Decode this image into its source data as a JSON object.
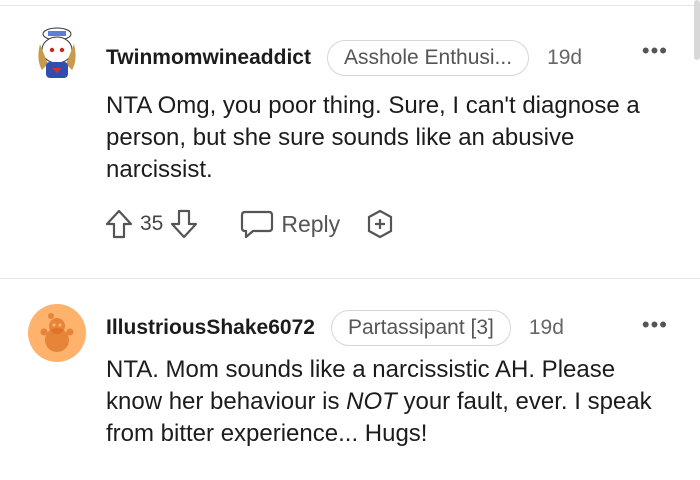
{
  "comments": [
    {
      "username": "Twinmomwineaddict",
      "flair": "Asshole Enthusi...",
      "age": "19d",
      "more": "•••",
      "body": "NTA Omg, you poor thing. Sure, I can't diagnose a person, but she sure sounds like an abusive narcissist.",
      "score": "35",
      "reply_label": "Reply"
    },
    {
      "username": "IllustriousShake6072",
      "flair": "Partassipant [3]",
      "age": "19d",
      "more": "•••",
      "body_before": "NTA. Mom sounds like a narcissistic AH. Please know her behaviour is ",
      "body_emph": "NOT",
      "body_after": " your fault, ever. I speak from bitter experience... Hugs!"
    }
  ],
  "colors": {
    "avatar2_bg": "#ffb26b",
    "accent_text": "#1c1c1c",
    "muted_text": "#666666"
  },
  "icons": [
    "upvote-icon",
    "downvote-icon",
    "reply-icon",
    "award-icon",
    "more-options-icon"
  ]
}
